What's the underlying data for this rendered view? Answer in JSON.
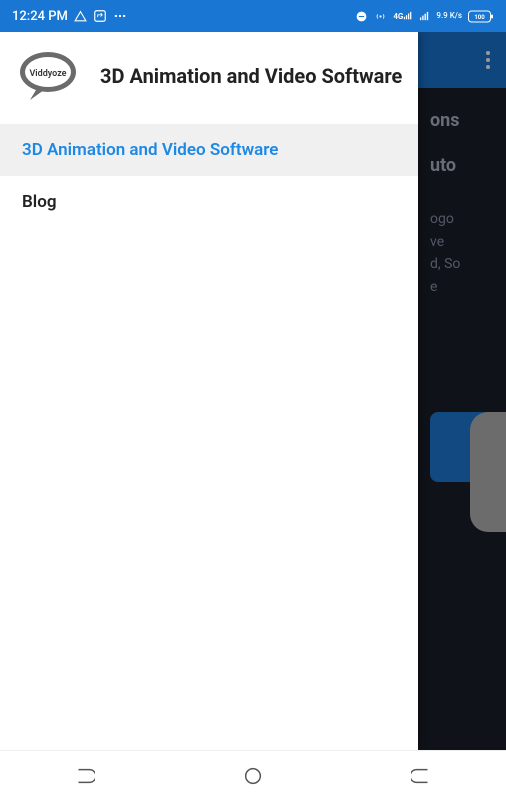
{
  "status": {
    "time": "12:24 PM",
    "left_icons": [
      "triangle-icon",
      "loop-icon",
      "more-icon"
    ],
    "right_icons": [
      "minus-circle-icon",
      "hotspot-icon",
      "signal-4g-icon",
      "signal-bars-icon"
    ],
    "speed": "9.9 K/s",
    "battery": "100"
  },
  "appbar": {
    "overflow_label": "More options"
  },
  "drawer": {
    "title": "3D Animation and Video Software",
    "logo_text": "Viddyoze",
    "items": [
      {
        "label": "3D Animation and Video Software",
        "active": true
      },
      {
        "label": "Blog",
        "active": false
      }
    ]
  },
  "bg": {
    "word1": "ons",
    "word2": "uto",
    "p1": "ogo",
    "p2": "ve",
    "p3": "d, So",
    "p4": "e"
  },
  "nav": {
    "recents": "Recents",
    "home": "Home",
    "back": "Back"
  }
}
